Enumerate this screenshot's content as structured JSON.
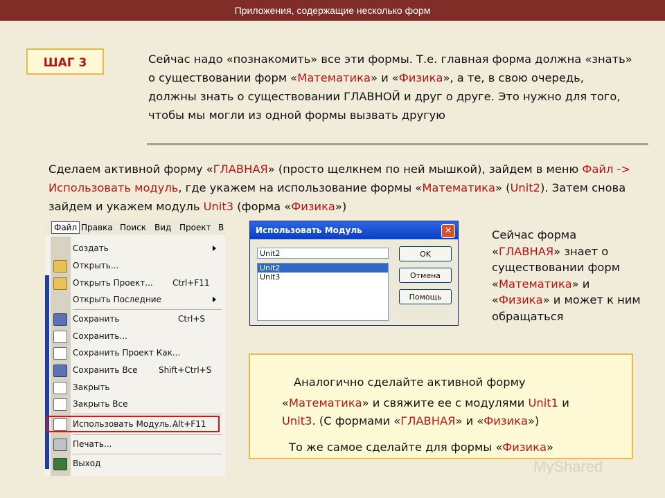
{
  "header": {
    "title": "Приложения, содержащие несколько форм"
  },
  "step_badge": "ШАГ 3",
  "intro": [
    {
      "t": "Сейчас надо «познакомить» все эти формы.  Т.е. главная форма должна «знать» о существовании форм «"
    },
    {
      "t": "Математика",
      "hl": true
    },
    {
      "t": "» и «"
    },
    {
      "t": "Физика",
      "hl": true
    },
    {
      "t": "», а те, в свою очередь, должны знать о существовании ГЛАВНОЙ и друг о друге. Это нужно для того, чтобы мы могли из одной формы вызвать другую"
    }
  ],
  "instruction": [
    {
      "t": "Сделаем активной форму «"
    },
    {
      "t": "ГЛАВНАЯ",
      "hl": true
    },
    {
      "t": "» (просто щелкнем по ней мышкой), зайдем в меню "
    },
    {
      "t": "Файл -> Использовать модуль",
      "hl": true
    },
    {
      "t": ", где укажем на использование формы «"
    },
    {
      "t": "Математика",
      "hl": true
    },
    {
      "t": "» ("
    },
    {
      "t": "Unit2",
      "hl": true
    },
    {
      "t": "). Затем снова зайдем и укажем модуль "
    },
    {
      "t": "Unit3",
      "hl": true
    },
    {
      "t": " (форма «"
    },
    {
      "t": "Физика",
      "hl": true
    },
    {
      "t": "»)"
    }
  ],
  "side_note": [
    {
      "t": "Сейчас форма «"
    },
    {
      "t": "ГЛАВНАЯ",
      "hl": true
    },
    {
      "t": "» знает о существовании форм «"
    },
    {
      "t": "Математика",
      "hl": true
    },
    {
      "t": "» и «"
    },
    {
      "t": "Физика",
      "hl": true
    },
    {
      "t": "» и может к ним обращаться"
    }
  ],
  "menu": {
    "bar": [
      "Файл",
      "Правка",
      "Поиск",
      "Вид",
      "Проект",
      "В"
    ],
    "items": [
      {
        "label": "Создать",
        "shortcut": "",
        "submenu": true,
        "icon": "none"
      },
      {
        "label": "Открыть...",
        "shortcut": "",
        "icon": "open-icon"
      },
      {
        "label": "Открыть Проект...",
        "shortcut": "Ctrl+F11",
        "icon": "open-project-icon"
      },
      {
        "label": "Открыть Последние",
        "shortcut": "",
        "submenu": true,
        "icon": "none"
      },
      {
        "label": "Сохранить",
        "shortcut": "Ctrl+S",
        "icon": "save-icon"
      },
      {
        "label": "Сохранить...",
        "shortcut": "",
        "icon": "save-as-icon"
      },
      {
        "label": "Сохранить Проект Как...",
        "shortcut": "",
        "icon": "save-project-icon"
      },
      {
        "label": "Сохранить Все",
        "shortcut": "Shift+Ctrl+S",
        "icon": "save-all-icon"
      },
      {
        "label": "Закрыть",
        "shortcut": "",
        "icon": "close-icon"
      },
      {
        "label": "Закрыть Все",
        "shortcut": "",
        "icon": "close-all-icon"
      },
      {
        "label": "Использовать Модуль...",
        "shortcut": "Alt+F11",
        "icon": "use-unit-icon"
      },
      {
        "label": "Печать...",
        "shortcut": "",
        "icon": "print-icon"
      },
      {
        "label": "Выход",
        "shortcut": "",
        "icon": "exit-icon"
      }
    ]
  },
  "dialog": {
    "title": "Использовать Модуль",
    "input_value": "Unit2",
    "list": [
      "Unit2",
      "Unit3"
    ],
    "selected": "Unit2",
    "buttons": [
      "OK",
      "Отмена",
      "Помощь"
    ]
  },
  "box": {
    "line1": "Аналогично сделайте активной форму",
    "line2": [
      {
        "t": "«"
      },
      {
        "t": "Математика",
        "hl": true
      },
      {
        "t": "» и свяжите ее с модулями "
      },
      {
        "t": "Unit1",
        "hl": true
      },
      {
        "t": " и"
      }
    ],
    "line3": [
      {
        "t": "Unit3",
        "hl": true
      },
      {
        "t": ". (С формами «"
      },
      {
        "t": "ГЛАВНАЯ",
        "hl": true
      },
      {
        "t": "» и «"
      },
      {
        "t": "Физика",
        "hl": true
      },
      {
        "t": "»)"
      }
    ],
    "line4": [
      {
        "t": "То же самое сделайте для формы «"
      },
      {
        "t": "Физика",
        "hl": true
      },
      {
        "t": "»"
      }
    ]
  },
  "watermark": "MyShared"
}
